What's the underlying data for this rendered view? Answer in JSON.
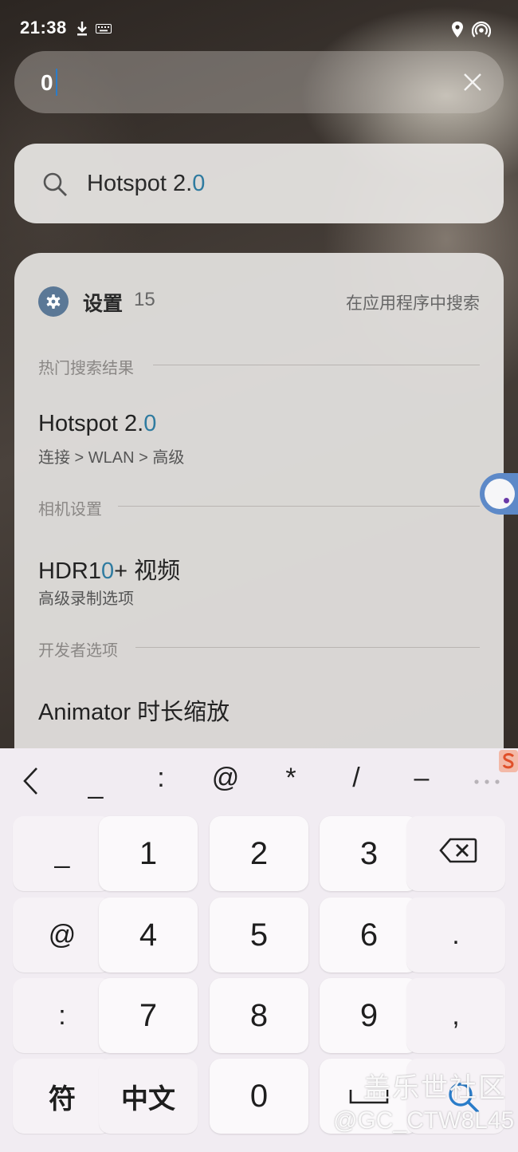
{
  "status_bar": {
    "time": "21:38"
  },
  "search": {
    "value": "0"
  },
  "suggestion": {
    "prefix": "Hotspot 2.",
    "highlight": "0"
  },
  "results_card": {
    "app_name": "设置",
    "count": "15",
    "search_in_app": "在应用程序中搜索",
    "sections": [
      {
        "label": "热门搜索结果",
        "title_prefix": "Hotspot 2.",
        "title_highlight": "0",
        "title_suffix": "",
        "subtitle": "连接 > WLAN > 高级"
      },
      {
        "label": "相机设置",
        "title_prefix": "HDR1",
        "title_highlight": "0",
        "title_suffix": "+ 视频",
        "subtitle": "高级录制选项"
      },
      {
        "label": "开发者选项",
        "title_prefix": "Animator 时长缩放",
        "title_highlight": "",
        "title_suffix": "",
        "subtitle": ""
      }
    ]
  },
  "keyboard": {
    "symbol_row": [
      "_",
      ":",
      "@",
      "*",
      "/",
      "–"
    ],
    "rows": [
      [
        "_",
        "1",
        "2",
        "3",
        ""
      ],
      [
        "@",
        "4",
        "5",
        "6",
        "."
      ],
      [
        ":",
        "7",
        "8",
        "9",
        ","
      ],
      [
        "符",
        "中文",
        "0",
        "",
        ""
      ]
    ]
  },
  "watermark": {
    "line1": "盖乐世社区",
    "line2": "@GC_CTW8L45"
  }
}
